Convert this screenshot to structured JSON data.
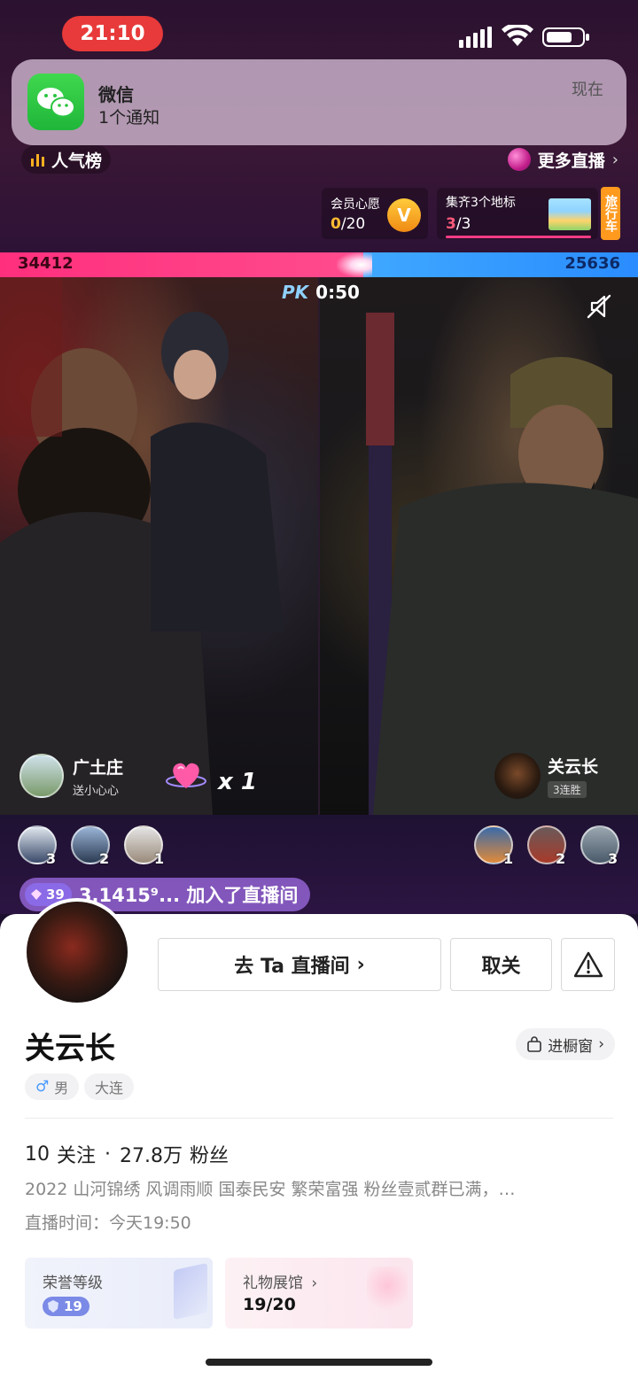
{
  "status_bar": {
    "time": "21:10"
  },
  "notification": {
    "app": "微信",
    "body": "1个通知",
    "time": "现在"
  },
  "top_bar": {
    "popularity_label": "人气榜",
    "more_live_label": "更多直播"
  },
  "wish_card": {
    "title": "会员心愿",
    "current": "0",
    "total": "/20",
    "badge": "V"
  },
  "collect_card": {
    "title": "集齐3个地标",
    "current": "3",
    "total": "/3"
  },
  "travel_tag": "旅行车",
  "pk": {
    "left_score": "34412",
    "right_score": "25636",
    "logo": "PK",
    "timer": "0:50",
    "left_share": 0.57
  },
  "left_host": {
    "name": "广土庄",
    "sub": "送小心心",
    "gift_count": "x 1"
  },
  "right_host": {
    "name": "关云长",
    "streak": "3连胜"
  },
  "left_contributors": [
    {
      "rank": "3"
    },
    {
      "rank": "2"
    },
    {
      "rank": "1"
    }
  ],
  "right_contributors": [
    {
      "rank": "1"
    },
    {
      "rank": "2"
    },
    {
      "rank": "3"
    }
  ],
  "join_banner": {
    "level": "39",
    "text": "3.1415⁹... 加入了直播间"
  },
  "profile": {
    "go_live_label": "去 Ta 直播间",
    "unfollow_label": "取关",
    "name": "关云长",
    "showcase_label": "进橱窗",
    "gender": "男",
    "city": "大连",
    "following": "10",
    "following_label": "关注",
    "followers": "27.8万",
    "followers_label": "粉丝",
    "bio": "2022 山河锦绣  风调雨顺  国泰民安  繁荣富强 粉丝壹贰群已满，…",
    "live_time": "直播时间：今天19:50",
    "honor_title": "荣誉等级",
    "honor_level": "19",
    "gift_hall_title": "礼物展馆",
    "gift_hall_progress": "19/20"
  },
  "colors": {
    "pk_left": "#ff2f7d",
    "pk_right": "#2a8cff",
    "accent": "#8a6ae6"
  }
}
